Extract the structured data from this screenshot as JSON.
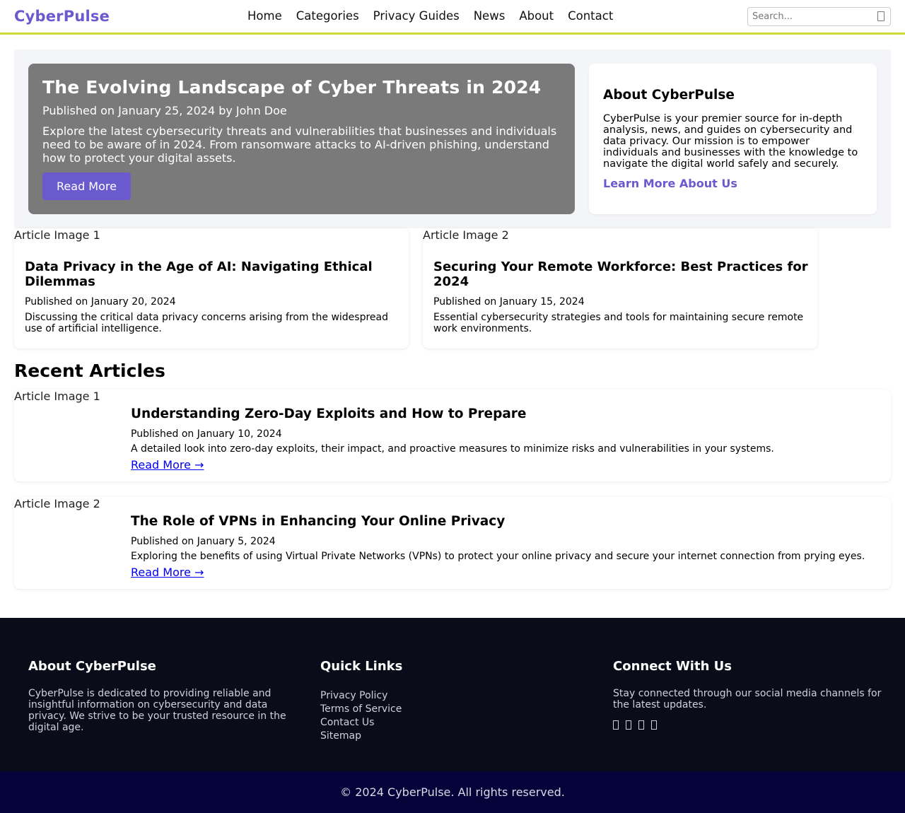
{
  "header": {
    "brand": "CyberPulse",
    "nav": [
      "Home",
      "Categories",
      "Privacy Guides",
      "News",
      "About",
      "Contact"
    ],
    "search_placeholder": "Search..."
  },
  "hero": {
    "title": "The Evolving Landscape of Cyber Threats in 2024",
    "meta": "Published on January 25, 2024 by John Doe",
    "text": "Explore the latest cybersecurity threats and vulnerabilities that businesses and individuals need to be aware of in 2024. From ransomware attacks to AI-driven phishing, understand how to protect your digital assets.",
    "button": "Read More"
  },
  "about": {
    "title": "About CyberPulse",
    "text": "CyberPulse is your premier source for in-depth analysis, news, and guides on cybersecurity and data privacy. Our mission is to empower individuals and businesses with the knowledge to navigate the digital world safely and securely.",
    "link": "Learn More About Us"
  },
  "featured": [
    {
      "image_alt": "Article Image 1",
      "title": "Data Privacy in the Age of AI: Navigating Ethical Dilemmas",
      "date": "Published on January 20, 2024",
      "desc": "Discussing the critical data privacy concerns arising from the widespread use of artificial intelligence."
    },
    {
      "image_alt": "Article Image 2",
      "title": "Securing Your Remote Workforce: Best Practices for 2024",
      "date": "Published on January 15, 2024",
      "desc": "Essential cybersecurity strategies and tools for maintaining secure remote work environments."
    }
  ],
  "recent": {
    "title": "Recent Articles",
    "items": [
      {
        "image_alt": "Article Image 1",
        "title": "Understanding Zero-Day Exploits and How to Prepare",
        "date": "Published on January 10, 2024",
        "desc": "A detailed look into zero-day exploits, their impact, and proactive measures to minimize risks and vulnerabilities in your systems.",
        "link": "Read More →"
      },
      {
        "image_alt": "Article Image 2",
        "title": "The Role of VPNs in Enhancing Your Online Privacy",
        "date": "Published on January 5, 2024",
        "desc": "Exploring the benefits of using Virtual Private Networks (VPNs) to protect your online privacy and secure your internet connection from prying eyes.",
        "link": "Read More →"
      }
    ]
  },
  "footer": {
    "about_title": "About CyberPulse",
    "about_text": "CyberPulse is dedicated to providing reliable and insightful information on cybersecurity and data privacy. We strive to be your trusted resource in the digital age.",
    "links_title": "Quick Links",
    "links": [
      "Privacy Policy",
      "Terms of Service",
      "Contact Us",
      "Sitemap"
    ],
    "connect_title": "Connect With Us",
    "connect_text": "Stay connected through our social media channels for the latest updates.",
    "social_icons": [
      "facebook-icon",
      "twitter-icon",
      "linkedin-icon",
      "instagram-icon"
    ],
    "copyright": "© 2024 CyberPulse. All rights reserved."
  },
  "colors": {
    "accent": "#6a5acd",
    "header_border": "#cddc39",
    "hero_bg": "#7a7a7a",
    "footer_bg": "#0b0c1a",
    "copyright_bg": "#03033a"
  }
}
